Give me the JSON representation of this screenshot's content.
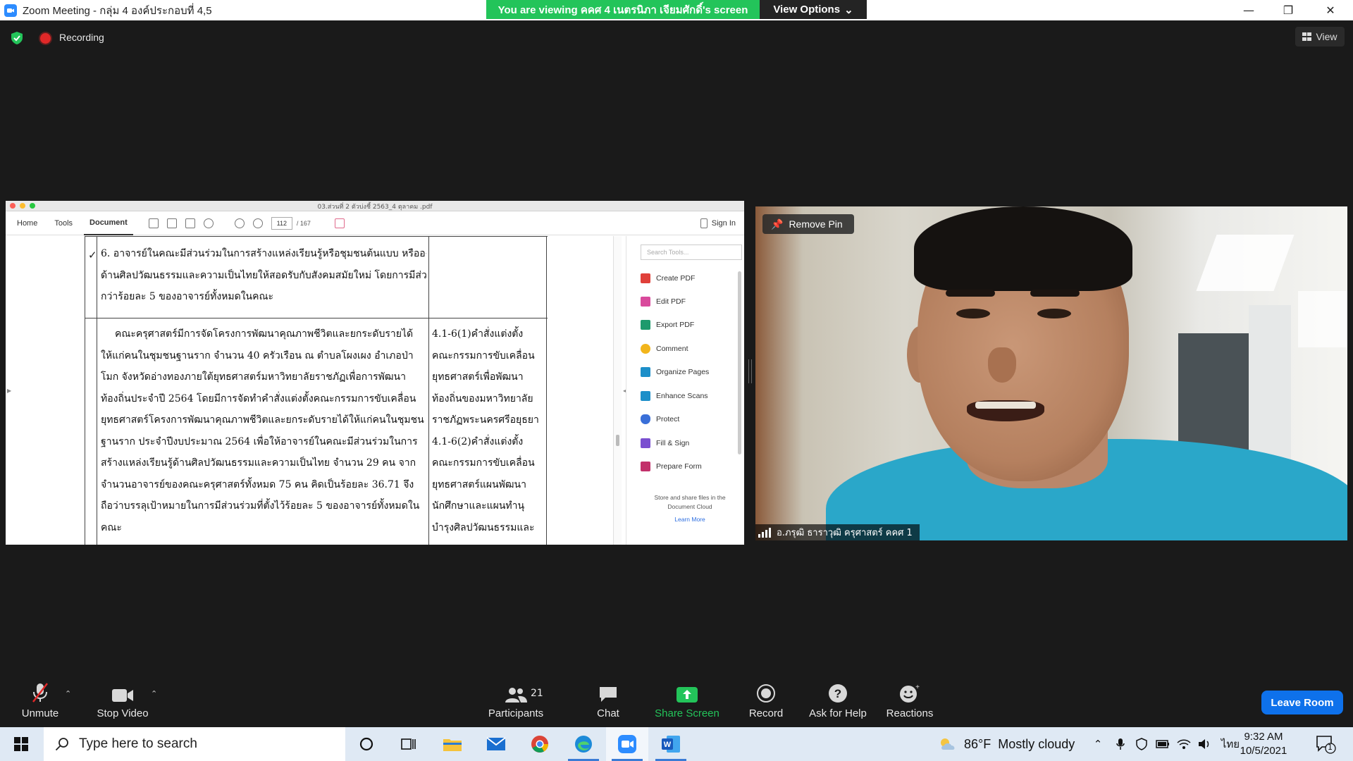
{
  "window": {
    "title": "Zoom Meeting - กลุ่ม 4 องค์ประกอบที่ 4,5",
    "viewing_banner": "You are viewing คคศ 4 เนตรนิภา เจียมศักดิ์'s screen",
    "view_options": "View Options"
  },
  "header": {
    "recording_label": "Recording",
    "view_label": "View"
  },
  "pdf_viewer": {
    "file_title": "03.ส่วนที่ 2 ตัวบ่งชี้ 2563_4 ตุลาคม .pdf",
    "tabs": [
      "Home",
      "Tools",
      "Document"
    ],
    "active_tab": "Document",
    "page_current": "112",
    "page_total": "/ 167",
    "sign_in": "Sign In",
    "search_placeholder": "Search Tools...",
    "tools": [
      {
        "label": "Create PDF",
        "color": "#e0403a"
      },
      {
        "label": "Edit PDF",
        "color": "#d94a9c"
      },
      {
        "label": "Export PDF",
        "color": "#1d9a6c"
      },
      {
        "label": "Comment",
        "color": "#f2b51c"
      },
      {
        "label": "Organize Pages",
        "color": "#1d8fc9"
      },
      {
        "label": "Enhance Scans",
        "color": "#1d8fc9"
      },
      {
        "label": "Protect",
        "color": "#3a6fd8"
      },
      {
        "label": "Fill & Sign",
        "color": "#7a4fd0"
      },
      {
        "label": "Prepare Form",
        "color": "#c2306a"
      }
    ],
    "cloud_note": "Store and share files in the Document Cloud",
    "learn_more": "Learn More",
    "criterion_lines": [
      "6. อาจารย์ในคณะมีส่วนร่วมในการสร้างแหล่งเรียนรู้หรือชุมชนต้นแบบ หรือองค์ความรู้หรือนวัตกรรม",
      "ด้านศิลปวัฒนธรรมและความเป็นไทยให้สอดรับกับสังคมสมัยใหม่ โดยการมีส่วนร่วมของอาจารย์ไม่น้อย",
      "กว่าร้อยละ 5 ของอาจารย์ทั้งหมดในคณะ"
    ],
    "result_lines": [
      "คณะครุศาสตร์มีการจัดโครงการพัฒนาคุณภาพชีวิตและยกระดับรายได้",
      "ให้แก่คนในชุมชนฐานราก จำนวน 40 ครัวเรือน ณ ตำบลโผงเผง อำเภอป่า",
      "โมก จังหวัดอ่างทองภายใต้ยุทธศาสตร์มหาวิทยาลัยราชภัฏเพื่อการพัฒนา",
      "ท้องถิ่นประจำปี 2564 โดยมีการจัดทำคำสั่งแต่งตั้งคณะกรรมการขับเคลื่อน",
      "ยุทธศาสตร์โครงการพัฒนาคุณภาพชีวิตและยกระดับรายได้ให้แก่คนในชุมชน",
      "ฐานราก ประจำปีงบประมาณ 2564 เพื่อให้อาจารย์ในคณะมีส่วนร่วมในการ",
      "สร้างแหล่งเรียนรู้ด้านศิลปวัฒนธรรมและความเป็นไทย จำนวน 29 คน จาก",
      "จำนวนอาจารย์ของคณะครุศาสตร์ทั้งหมด 75 คน คิดเป็นร้อยละ 36.71 จึง",
      "ถือว่าบรรลุเป้าหมายในการมีส่วนร่วมที่ตั้งไว้ร้อยละ 5 ของอาจารย์ทั้งหมดใน",
      "คณะ"
    ],
    "evidence_lines": [
      "4.1-6(1)คำสั่งแต่งตั้ง",
      "คณะกรรมการขับเคลื่อน",
      "ยุทธศาสตร์เพื่อพัฒนา",
      "ท้องถิ่นของมหาวิทยาลัย",
      "ราชภัฏพระนครศรีอยุธยา",
      "4.1-6(2)คำสั่งแต่งตั้ง",
      "คณะกรรมการขับเคลื่อน",
      "ยุทธศาสตร์แผนพัฒนา",
      "นักศึกษาและแผนทำนุ",
      "บำรุงศิลปวัฒนธรรมและ"
    ]
  },
  "video": {
    "remove_pin": "Remove Pin",
    "participant_name": "อ.ภรุฒิ ธาราวุฒิ ครุศาสตร์ คคศ 1"
  },
  "toolbar": {
    "unmute": "Unmute",
    "stop_video": "Stop Video",
    "participants": "Participants",
    "participant_count": "21",
    "chat": "Chat",
    "share_screen": "Share Screen",
    "record": "Record",
    "ask_for_help": "Ask for Help",
    "reactions": "Reactions",
    "leave_room": "Leave Room"
  },
  "taskbar": {
    "search_placeholder": "Type here to search",
    "weather_temp": "86°F",
    "weather_desc": "Mostly cloudy",
    "ime": "ไทย",
    "time": "9:32 AM",
    "date": "10/5/2021",
    "notification_count": "1"
  },
  "colors": {
    "zoom_blue": "#0e71eb",
    "zoom_green": "#23c45a",
    "record_red": "#e02828"
  }
}
